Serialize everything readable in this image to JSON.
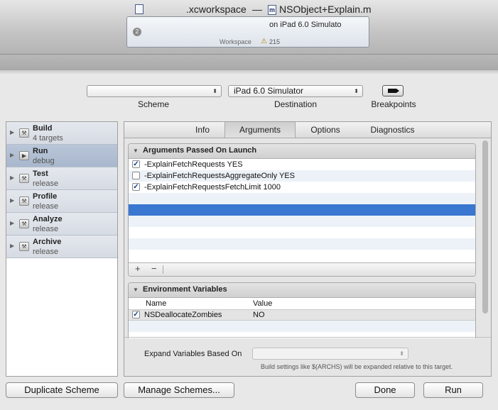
{
  "window": {
    "workspace_title": ".xcworkspace",
    "title_separator": "—",
    "file_title": "NSObject+Explain.m",
    "file_badge": "m"
  },
  "status": {
    "badge": "2",
    "destination": "on iPad 6.0 Simulato",
    "workspace_label": "Workspace",
    "warning_icon": "⚠",
    "warning_count": "215"
  },
  "toolbar": {
    "scheme_value": "",
    "scheme_caption": "Scheme",
    "destination_value": "iPad 6.0 Simulator",
    "destination_caption": "Destination",
    "breakpoints_caption": "Breakpoints",
    "popup_arrow": "⬍"
  },
  "sidebar": {
    "items": [
      {
        "name": "Build",
        "sub": "4 targets"
      },
      {
        "name": "Run",
        "sub": "debug"
      },
      {
        "name": "Test",
        "sub": "release"
      },
      {
        "name": "Profile",
        "sub": "release"
      },
      {
        "name": "Analyze",
        "sub": "release"
      },
      {
        "name": "Archive",
        "sub": "release"
      }
    ]
  },
  "tabs": [
    "Info",
    "Arguments",
    "Options",
    "Diagnostics"
  ],
  "arguments": {
    "header": "Arguments Passed On Launch",
    "rows": [
      {
        "text": "-ExplainFetchRequests YES",
        "checked": true
      },
      {
        "text": "-ExplainFetchRequestsAggregateOnly YES",
        "checked": false
      },
      {
        "text": "-ExplainFetchRequestsFetchLimit 1000",
        "checked": true
      }
    ],
    "add_label": "+",
    "remove_label": "−"
  },
  "environment": {
    "header": "Environment Variables",
    "col_name": "Name",
    "col_value": "Value",
    "rows": [
      {
        "name": "NSDeallocateZombies",
        "value": "NO",
        "checked": true
      }
    ]
  },
  "expand": {
    "label": "Expand Variables Based On",
    "value": "",
    "hint": "Build settings like $(ARCHS) will be expanded relative to this target."
  },
  "buttons": {
    "duplicate": "Duplicate Scheme",
    "manage": "Manage Schemes...",
    "done": "Done",
    "run": "Run"
  },
  "check_glyph": "✓"
}
